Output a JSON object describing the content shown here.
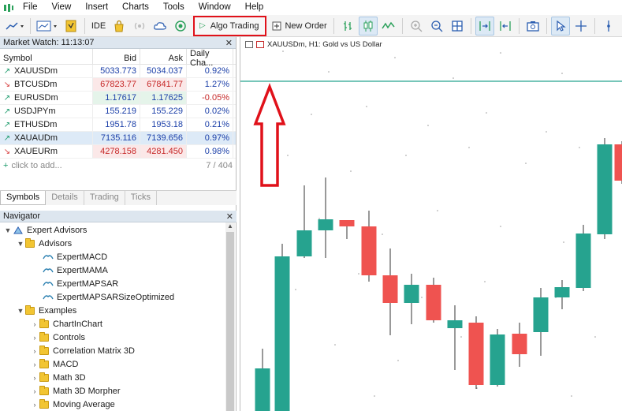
{
  "menu": {
    "items": [
      "File",
      "View",
      "Insert",
      "Charts",
      "Tools",
      "Window",
      "Help"
    ]
  },
  "toolbar": {
    "ide_label": "IDE",
    "algo_trading_label": "Algo Trading",
    "new_order_label": "New Order"
  },
  "market_watch": {
    "title": "Market Watch: 11:13:07",
    "columns": [
      "Symbol",
      "Bid",
      "Ask",
      "Daily Cha..."
    ],
    "rows": [
      {
        "symbol": "XAUUSDm",
        "bid": "5033.773",
        "ask": "5034.037",
        "change": "0.92%",
        "dir": "up"
      },
      {
        "symbol": "BTCUSDm",
        "bid": "67823.77",
        "ask": "67841.77",
        "change": "1.27%",
        "dir": "down"
      },
      {
        "symbol": "EURUSDm",
        "bid": "1.17617",
        "ask": "1.17625",
        "change": "-0.05%",
        "dir": "up"
      },
      {
        "symbol": "USDJPYm",
        "bid": "155.219",
        "ask": "155.229",
        "change": "0.02%",
        "dir": "up"
      },
      {
        "symbol": "ETHUSDm",
        "bid": "1951.78",
        "ask": "1953.18",
        "change": "0.21%",
        "dir": "up"
      },
      {
        "symbol": "XAUAUDm",
        "bid": "7135.116",
        "ask": "7139.656",
        "change": "0.97%",
        "dir": "up"
      },
      {
        "symbol": "XAUEURm",
        "bid": "4278.158",
        "ask": "4281.450",
        "change": "0.98%",
        "dir": "down"
      }
    ],
    "add_placeholder": "click to add...",
    "count": "7 / 404"
  },
  "mw_tabs": [
    "Symbols",
    "Details",
    "Trading",
    "Ticks"
  ],
  "navigator": {
    "title": "Navigator",
    "root": "Expert Advisors",
    "advisors_folder": "Advisors",
    "advisors": [
      "ExpertMACD",
      "ExpertMAMA",
      "ExpertMAPSAR",
      "ExpertMAPSARSizeOptimized"
    ],
    "examples_folder": "Examples",
    "examples": [
      "ChartInChart",
      "Controls",
      "Correlation Matrix 3D",
      "MACD",
      "Math 3D",
      "Math 3D Morpher",
      "Moving Average"
    ]
  },
  "chart": {
    "title": "XAUUSDm, H1:  Gold vs US Dollar",
    "colors": {
      "bull": "#26a38f",
      "bear": "#ef5350",
      "level": "#26a38f",
      "annotation": "#e0111a"
    }
  }
}
